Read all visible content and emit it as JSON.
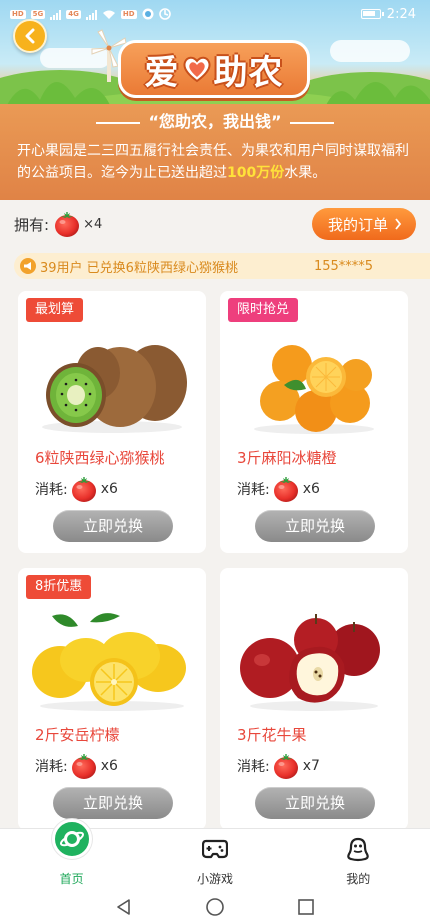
{
  "status_bar": {
    "time": "2:24",
    "left_badges": [
      "HD",
      "5G",
      "4G",
      "HD"
    ]
  },
  "banner": {
    "title_left": "爱",
    "title_right": "助农",
    "slogan": "“您助农，我出钱”",
    "intro_before": "开心果园是二三四五履行社会责任、为果农和用户同时谋取福利的公益项目。迄今为止已送出超过",
    "intro_highlight": "100万份",
    "intro_after": "水果。"
  },
  "owned": {
    "label": "拥有:",
    "count": "×4"
  },
  "orders_button": "我的订单",
  "ticker": {
    "message": "39用户 已兑换6粒陕西绿心猕猴桃",
    "next": "155****5"
  },
  "products": [
    {
      "tag": "最划算",
      "name": "6粒陕西绿心猕猴桃",
      "cost_label": "消耗:",
      "cost": "x6",
      "button": "立即兑换",
      "fruit": "kiwi-image",
      "tag_color": "#ee4b37"
    },
    {
      "tag": "限时抢兑",
      "name": "3斤麻阳冰糖橙",
      "cost_label": "消耗:",
      "cost": "x6",
      "button": "立即兑换",
      "fruit": "orange-image",
      "tag_color": "#ee3f7d"
    },
    {
      "tag": "8折优惠",
      "name": "2斤安岳柠檬",
      "cost_label": "消耗:",
      "cost": "x6",
      "button": "立即兑换",
      "fruit": "lemon-image",
      "tag_color": "#ee4b37"
    },
    {
      "tag": "",
      "name": "3斤花牛果",
      "cost_label": "消耗:",
      "cost": "x7",
      "button": "立即兑换",
      "fruit": "apple-image",
      "tag_color": ""
    }
  ],
  "bottom_nav": [
    {
      "label": "首页",
      "icon": "planet-icon",
      "active": true
    },
    {
      "label": "小游戏",
      "icon": "gamepad-icon",
      "active": false
    },
    {
      "label": "我的",
      "icon": "penguin-icon",
      "active": false
    }
  ],
  "system_nav": [
    "back-triangle-icon",
    "home-circle-icon",
    "recents-square-icon"
  ],
  "colors": {
    "accent_orange": "#f06a1c",
    "product_name_red": "#e8473b",
    "active_green": "#1fa85a",
    "highlight_yellow": "#ffe23a"
  }
}
